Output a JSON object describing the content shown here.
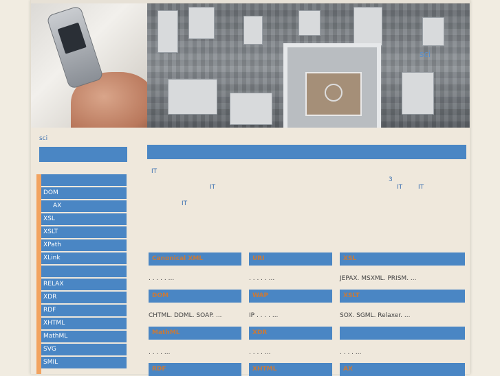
{
  "header": {
    "logo_text": "sci"
  },
  "breadcrumb": {
    "label": "sci"
  },
  "sidebar": {
    "items": [
      {
        "label": "",
        "indent": false
      },
      {
        "label": "DOM",
        "indent": false
      },
      {
        "label": "AX",
        "indent": true
      },
      {
        "label": "XSL",
        "indent": false
      },
      {
        "label": "XSLT",
        "indent": false
      },
      {
        "label": "XPath",
        "indent": false
      },
      {
        "label": "XLink",
        "indent": false
      },
      {
        "label": "",
        "indent": false
      },
      {
        "label": "RELAX",
        "indent": false
      },
      {
        "label": "XDR",
        "indent": false
      },
      {
        "label": "RDF",
        "indent": false
      },
      {
        "label": "XHTML",
        "indent": false
      },
      {
        "label": "MathML",
        "indent": false
      },
      {
        "label": "SVG",
        "indent": false
      },
      {
        "label": "SMIL",
        "indent": false
      }
    ]
  },
  "intro": {
    "t1": "IT",
    "t2": "3",
    "t3": "IT",
    "t4": "IT",
    "t5": "IT",
    "t6": "IT"
  },
  "cards": [
    {
      "title": "Canonical XML",
      "text": ". . . . . ..."
    },
    {
      "title": "URI",
      "text": ". . . . . ..."
    },
    {
      "title": "XSL",
      "text": "JEPAX. MSXML. PRISM. ..."
    },
    {
      "title": "DOM",
      "text": "CHTML. DDML. SOAP. ..."
    },
    {
      "title": "WAP",
      "text": "IP . . . . ..."
    },
    {
      "title": "XSLT",
      "text": "SOX. SGML. Relaxer. ..."
    },
    {
      "title": "MathML",
      "text": ". . . . ..."
    },
    {
      "title": "XDR",
      "text": ". . . . ..."
    },
    {
      "title": "",
      "text": ". . . . ..."
    },
    {
      "title": "RDF",
      "text": ""
    },
    {
      "title": "XHTML",
      "text": ""
    },
    {
      "title": "AX",
      "text": ""
    }
  ],
  "colors": {
    "accent": "#4a86c4",
    "sidebar_stripe": "#f2a360",
    "card_title": "#c87a3a"
  }
}
